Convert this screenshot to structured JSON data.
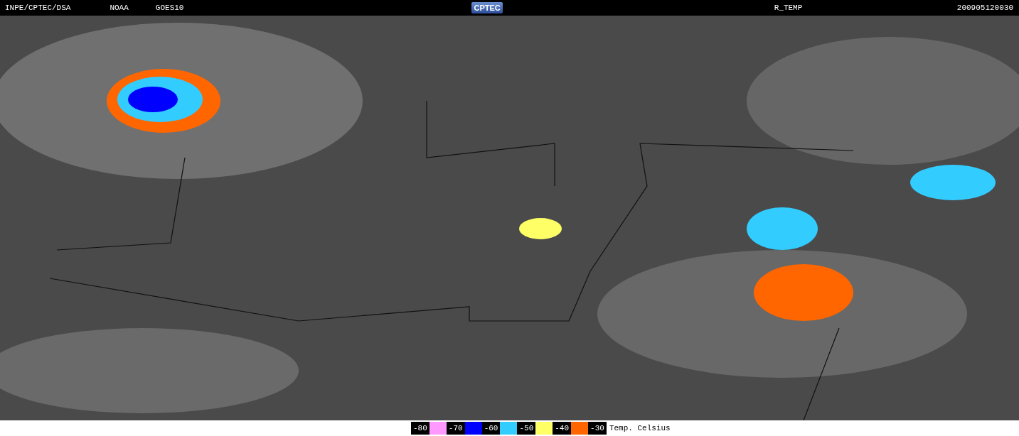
{
  "header": {
    "source": "INPE/CPTEC/DSA",
    "agency": "NOAA",
    "satellite": "GOES10",
    "logo": "CPTEC",
    "product": "R_TEMP",
    "timestamp": "200905120030"
  },
  "legend": {
    "items": [
      {
        "label": "-80",
        "color": "#ff99ff"
      },
      {
        "label": "-70",
        "color": "#0000ff"
      },
      {
        "label": "-60",
        "color": "#33ccff"
      },
      {
        "label": "-50",
        "color": "#ffff66"
      },
      {
        "label": "-40",
        "color": "#ff6600"
      },
      {
        "label": "-30"
      }
    ],
    "unit": "Temp. Celsius"
  }
}
